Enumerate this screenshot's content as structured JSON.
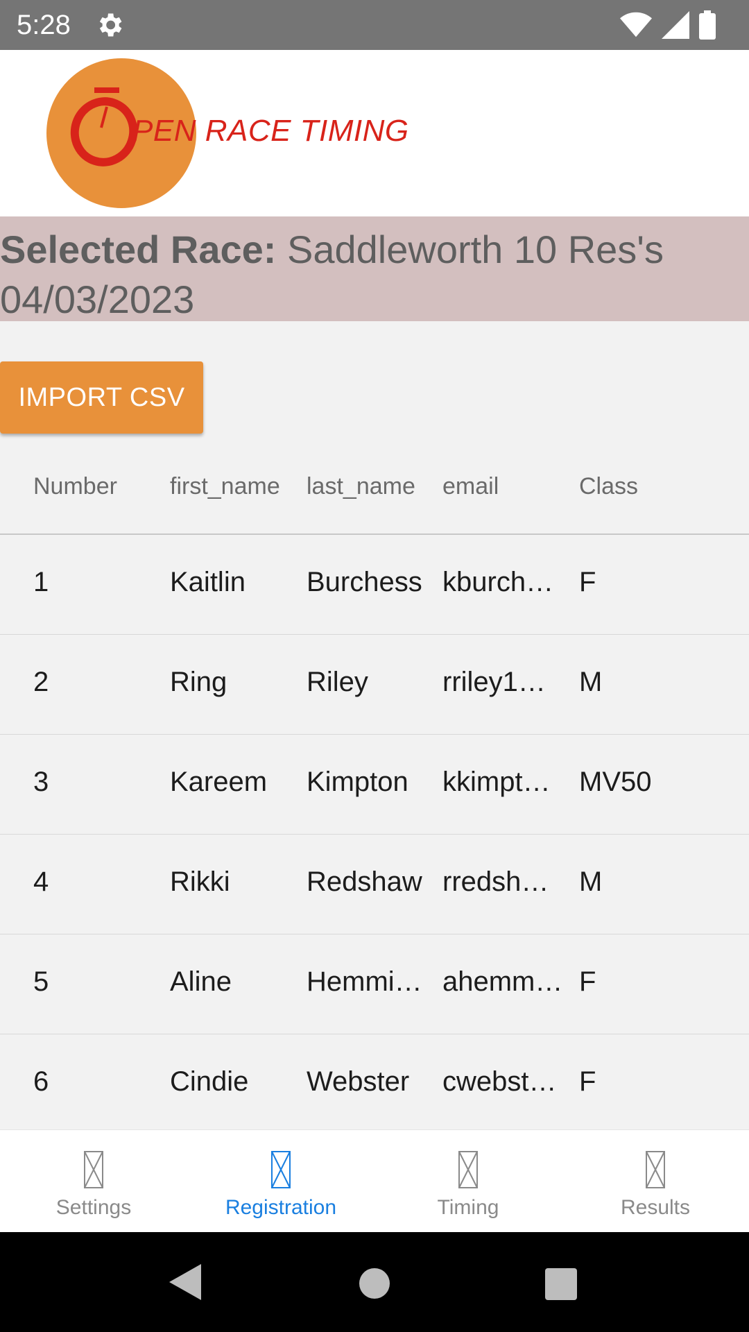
{
  "status_bar": {
    "time": "5:28"
  },
  "logo": {
    "text": "PEN RACE TIMING",
    "brand_color": "#e8913a",
    "text_color": "#d8231a"
  },
  "race": {
    "label": "Selected Race:",
    "name_line1": "Saddleworth 10 Res's",
    "name_line2": "04/03/2023"
  },
  "import_button": {
    "label": "IMPORT CSV"
  },
  "table": {
    "headers": [
      "Number",
      "first_name",
      "last_name",
      "email",
      "Class"
    ],
    "rows": [
      [
        "1",
        "Kaitlin",
        "Burchess",
        "kburche…",
        "F"
      ],
      [
        "2",
        "Ring",
        "Riley",
        "rriley1…",
        "M"
      ],
      [
        "3",
        "Kareem",
        "Kimpton",
        "kkimpt…",
        "MV50"
      ],
      [
        "4",
        "Rikki",
        "Redshaw",
        "rredsha…",
        "M"
      ],
      [
        "5",
        "Aline",
        "Hemmi…",
        "ahemm…",
        "F"
      ],
      [
        "6",
        "Cindie",
        "Webster",
        "cwebste…",
        "F"
      ]
    ]
  },
  "tabs": [
    {
      "label": "Settings",
      "icon": "placeholder-icon"
    },
    {
      "label": "Registration",
      "icon": "placeholder-icon",
      "active": true
    },
    {
      "label": "Timing",
      "icon": "placeholder-icon"
    },
    {
      "label": "Results",
      "icon": "placeholder-icon"
    }
  ],
  "colors": {
    "accent": "#e8913a",
    "active_tab": "#1a7fe0",
    "banner": "#d3bfbf"
  }
}
